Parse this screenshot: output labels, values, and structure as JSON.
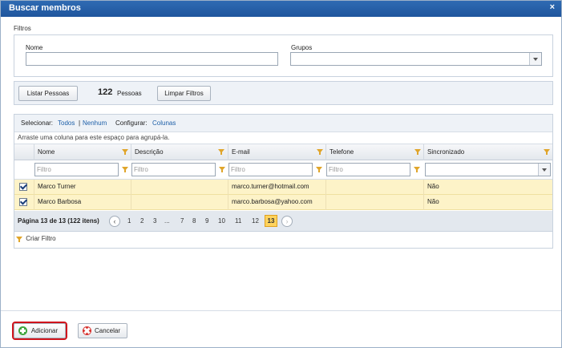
{
  "window": {
    "title": "Buscar membros",
    "close_glyph": "×"
  },
  "filters": {
    "section_label": "Filtros",
    "name_label": "Nome",
    "name_value": "",
    "groups_label": "Grupos",
    "groups_value": ""
  },
  "actions": {
    "list_button": "Listar Pessoas",
    "count": "122",
    "count_label": "Pessoas",
    "clear_button": "Limpar Filtros"
  },
  "grid": {
    "toolbar": {
      "select_label": "Selecionar:",
      "select_all": "Todos",
      "separator": "|",
      "select_none": "Nenhum",
      "configure_label": "Configurar:",
      "columns_link": "Colunas"
    },
    "group_hint": "Arraste uma coluna para este espaço para agrupá-la.",
    "columns": [
      "Nome",
      "Descrição",
      "E-mail",
      "Telefone",
      "Sincronizado"
    ],
    "filter_placeholder": "Filtro",
    "rows": [
      {
        "checked": true,
        "name": "Marco Turner",
        "description": "",
        "email": "marco.turner@hotmail.com",
        "phone": "",
        "synced": "Não"
      },
      {
        "checked": true,
        "name": "Marco Barbosa",
        "description": "",
        "email": "marco.barbosa@yahoo.com",
        "phone": "",
        "synced": "Não"
      }
    ],
    "pager": {
      "info": "Página 13 de 13 (122 itens)",
      "prev": "‹",
      "next": "›",
      "pages": [
        "1",
        "2",
        "3",
        "...",
        "7",
        "8",
        "9",
        "10",
        "11",
        "12",
        "13"
      ],
      "current": "13"
    },
    "create_filter": "Criar Filtro"
  },
  "footer": {
    "add_button": "Adicionar",
    "cancel_button": "Cancelar"
  },
  "colors": {
    "title_bar": "#2a62ab",
    "selected_row": "#fdf3c8",
    "active_page": "#ffd35c",
    "highlight_outline": "#d0141c"
  },
  "icons": [
    "close-icon",
    "filter-icon",
    "chevron-down-icon",
    "checkbox-checked-icon",
    "chevron-left-icon",
    "chevron-right-icon",
    "add-icon",
    "cancel-icon"
  ]
}
